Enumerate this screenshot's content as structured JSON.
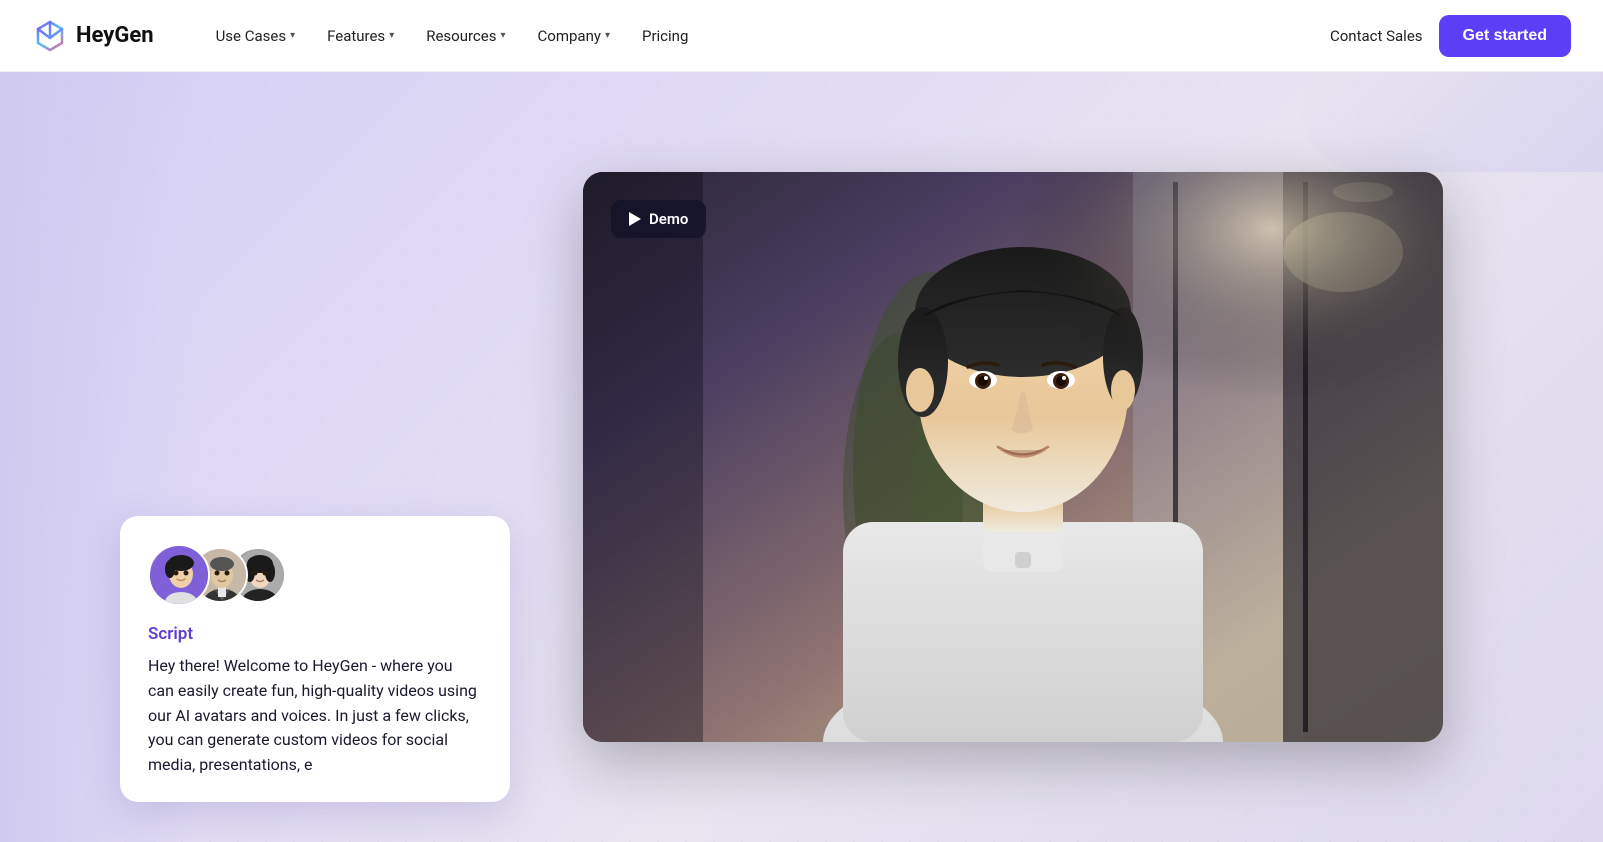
{
  "brand": {
    "name": "HeyGen",
    "logo_alt": "HeyGen logo"
  },
  "navbar": {
    "links": [
      {
        "label": "Use Cases",
        "has_dropdown": true
      },
      {
        "label": "Features",
        "has_dropdown": true
      },
      {
        "label": "Resources",
        "has_dropdown": true
      },
      {
        "label": "Company",
        "has_dropdown": true
      }
    ],
    "pricing_label": "Pricing",
    "contact_sales_label": "Contact Sales",
    "get_started_label": "Get started"
  },
  "hero": {
    "demo_badge_label": "Demo",
    "script": {
      "label": "Script",
      "text": "Hey there! Welcome to HeyGen - where you can easily create fun, high-quality videos using our AI avatars and voices. In just a few clicks, you can generate custom videos for social media, presentations, e"
    },
    "avatars": [
      {
        "name": "avatar-1",
        "bg": "#7060d0"
      },
      {
        "name": "avatar-2",
        "bg": "#b0a090"
      },
      {
        "name": "avatar-3",
        "bg": "#a0a0a0"
      }
    ]
  },
  "colors": {
    "brand_purple": "#5b3ef5",
    "script_label_color": "#6040d0",
    "nav_bg": "#ffffff",
    "hero_bg_start": "#d4cef5",
    "hero_bg_end": "#e8e4f0"
  }
}
